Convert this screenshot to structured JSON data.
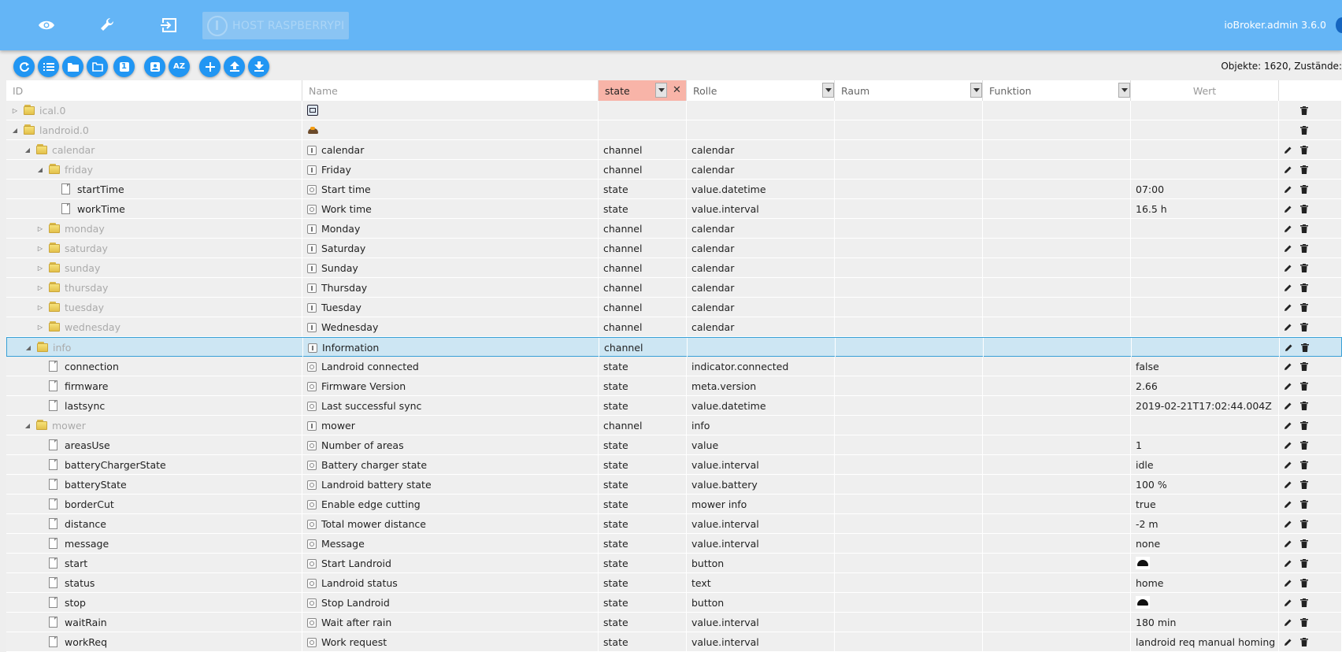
{
  "header": {
    "host_label": "HOST RASPBERRYPI",
    "version": "ioBroker.admin 3.6.0",
    "icons": [
      "eye-icon",
      "wrench-icon",
      "logout-icon"
    ]
  },
  "toolbar": {
    "buttons": [
      "refresh-icon",
      "list-icon",
      "folder-icon",
      "folder-outline-icon",
      "number-one-icon",
      "user-icon",
      "sort-az-icon",
      "add-icon",
      "upload-icon",
      "download-icon"
    ],
    "az_label": "AZ",
    "one_label": "1",
    "counts": "Objekte: 1620, Zustände:"
  },
  "columns": {
    "id": "ID",
    "name": "Name",
    "type_filter": "state",
    "role": "Rolle",
    "room": "Raum",
    "function": "Funktion",
    "value": "Wert"
  },
  "rows": [
    {
      "id": "ical.0",
      "name": "",
      "type": "",
      "role": "",
      "value": ""
    },
    {
      "id": "landroid.0",
      "name": "",
      "type": "",
      "role": "",
      "value": ""
    },
    {
      "id": "calendar",
      "name": "calendar",
      "type": "channel",
      "role": "calendar",
      "value": ""
    },
    {
      "id": "friday",
      "name": "Friday",
      "type": "channel",
      "role": "calendar",
      "value": ""
    },
    {
      "id": "startTime",
      "name": "Start time",
      "type": "state",
      "role": "value.datetime",
      "value": "07:00"
    },
    {
      "id": "workTime",
      "name": "Work time",
      "type": "state",
      "role": "value.interval",
      "value": "16.5 h"
    },
    {
      "id": "monday",
      "name": "Monday",
      "type": "channel",
      "role": "calendar",
      "value": ""
    },
    {
      "id": "saturday",
      "name": "Saturday",
      "type": "channel",
      "role": "calendar",
      "value": ""
    },
    {
      "id": "sunday",
      "name": "Sunday",
      "type": "channel",
      "role": "calendar",
      "value": ""
    },
    {
      "id": "thursday",
      "name": "Thursday",
      "type": "channel",
      "role": "calendar",
      "value": ""
    },
    {
      "id": "tuesday",
      "name": "Tuesday",
      "type": "channel",
      "role": "calendar",
      "value": ""
    },
    {
      "id": "wednesday",
      "name": "Wednesday",
      "type": "channel",
      "role": "calendar",
      "value": ""
    },
    {
      "id": "info",
      "name": "Information",
      "type": "channel",
      "role": "",
      "value": ""
    },
    {
      "id": "connection",
      "name": "Landroid connected",
      "type": "state",
      "role": "indicator.connected",
      "value": "false"
    },
    {
      "id": "firmware",
      "name": "Firmware Version",
      "type": "state",
      "role": "meta.version",
      "value": "2.66"
    },
    {
      "id": "lastsync",
      "name": "Last successful sync",
      "type": "state",
      "role": "value.datetime",
      "value": "2019-02-21T17:02:44.004Z"
    },
    {
      "id": "mower",
      "name": "mower",
      "type": "channel",
      "role": "info",
      "value": ""
    },
    {
      "id": "areasUse",
      "name": "Number of areas",
      "type": "state",
      "role": "value",
      "value": "1"
    },
    {
      "id": "batteryChargerState",
      "name": "Battery charger state",
      "type": "state",
      "role": "value.interval",
      "value": "idle"
    },
    {
      "id": "batteryState",
      "name": "Landroid battery state",
      "type": "state",
      "role": "value.battery",
      "value": "100 %"
    },
    {
      "id": "borderCut",
      "name": "Enable edge cutting",
      "type": "state",
      "role": "mower info",
      "value": "true"
    },
    {
      "id": "distance",
      "name": "Total mower distance",
      "type": "state",
      "role": "value.interval",
      "value": "-2 m"
    },
    {
      "id": "message",
      "name": "Message",
      "type": "state",
      "role": "value.interval",
      "value": "none"
    },
    {
      "id": "start",
      "name": "Start Landroid",
      "type": "state",
      "role": "button",
      "value": ""
    },
    {
      "id": "status",
      "name": "Landroid status",
      "type": "state",
      "role": "text",
      "value": "home"
    },
    {
      "id": "stop",
      "name": "Stop Landroid",
      "type": "state",
      "role": "button",
      "value": ""
    },
    {
      "id": "waitRain",
      "name": "Wait after rain",
      "type": "state",
      "role": "value.interval",
      "value": "180 min"
    },
    {
      "id": "workReq",
      "name": "Work request",
      "type": "state",
      "role": "value.interval",
      "value": "landroid req manual homing"
    }
  ]
}
